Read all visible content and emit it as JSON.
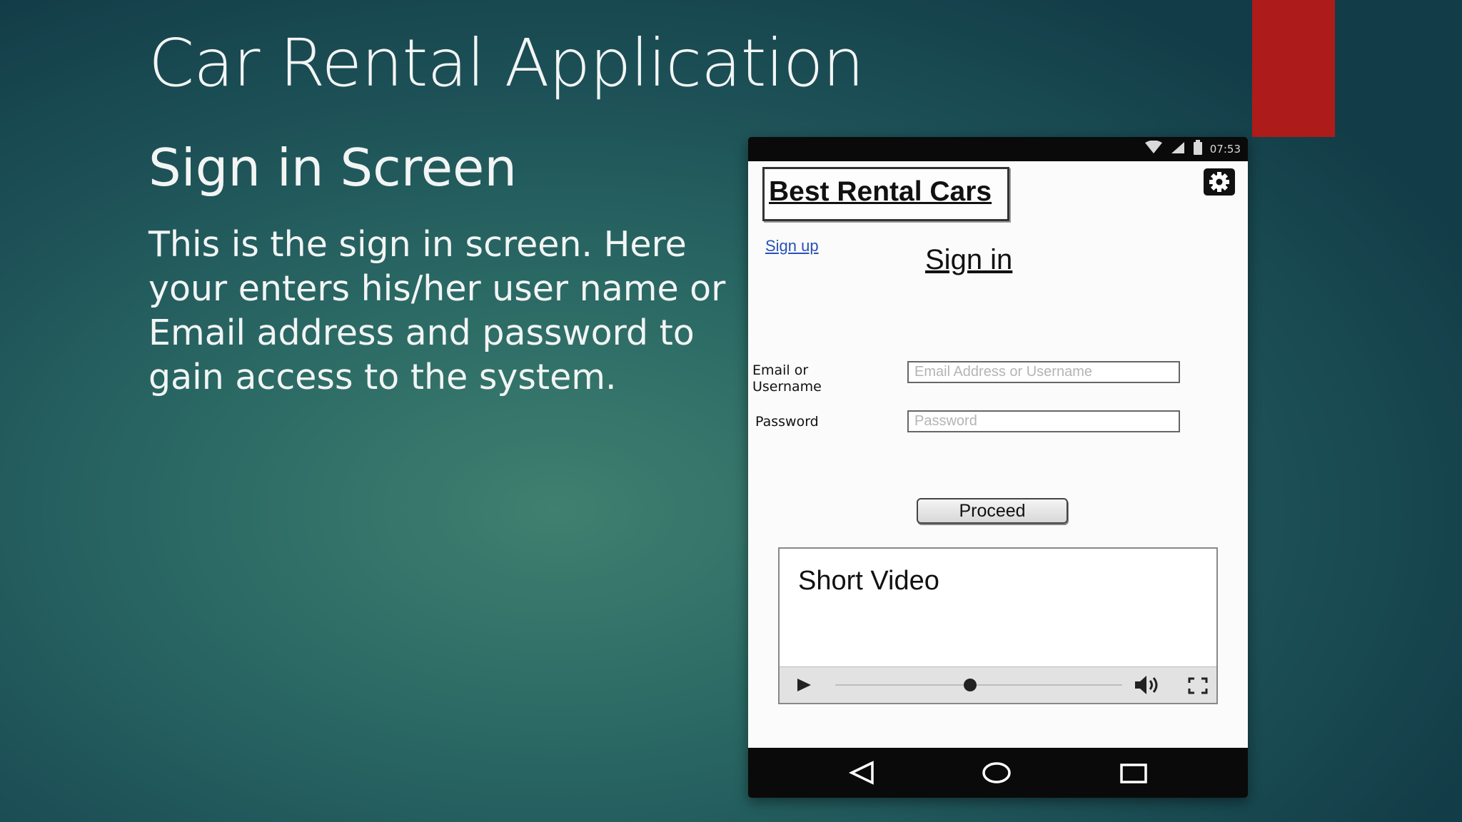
{
  "slide": {
    "title": "Car Rental Application",
    "subtitle": "Sign in Screen",
    "body": "This is the sign in screen. Here your enters his/her user name or Email address and password to gain access to the system."
  },
  "phone": {
    "status_bar": {
      "time": "07:53"
    },
    "app_title": "Best Rental Cars",
    "signup_link": "Sign up",
    "signin_heading": "Sign in",
    "form": {
      "email_label_line1": "Email or",
      "email_label_line2": "Username",
      "email_placeholder": "Email Address or Username",
      "password_label": "Password",
      "password_placeholder": "Password",
      "submit_label": "Proceed"
    },
    "video": {
      "title": "Short Video",
      "progress": 0.47
    }
  },
  "icons": {
    "settings": "gear-icon",
    "wifi": "wifi-icon",
    "signal": "signal-icon",
    "battery": "battery-icon",
    "play": "play-icon",
    "volume": "volume-icon",
    "fullscreen": "fullscreen-icon",
    "back": "back-icon",
    "home": "home-icon",
    "recent": "recent-apps-icon"
  },
  "colors": {
    "accent_red": "#ad1c1a",
    "link_blue": "#2850b8"
  }
}
